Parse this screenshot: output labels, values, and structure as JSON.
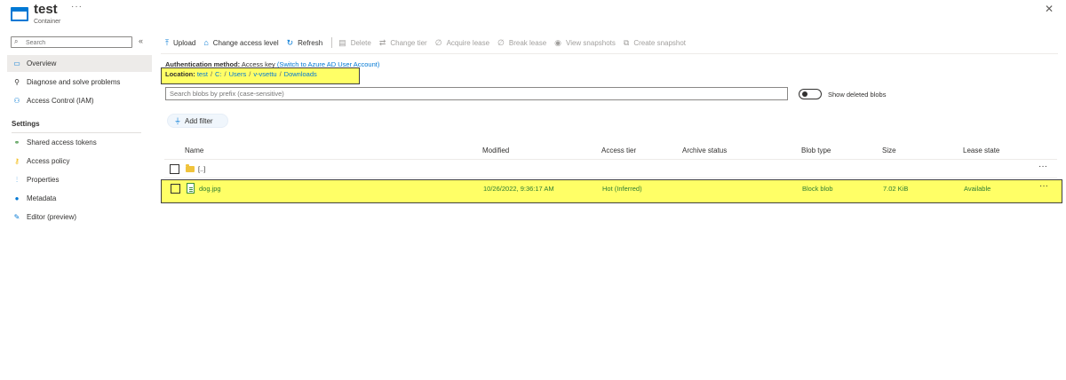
{
  "header": {
    "title": "test",
    "more_label": "···",
    "subtitle": "Container",
    "close_label": "✕"
  },
  "sidebar": {
    "search_placeholder": "Search",
    "collapse_label": "«",
    "items": [
      {
        "label": "Overview",
        "icon": "overview-icon",
        "active": true
      },
      {
        "label": "Diagnose and solve problems",
        "icon": "wrench-icon",
        "active": false
      },
      {
        "label": "Access Control (IAM)",
        "icon": "people-icon",
        "active": false
      }
    ],
    "section_title": "Settings",
    "settings_items": [
      {
        "label": "Shared access tokens",
        "icon": "link-icon"
      },
      {
        "label": "Access policy",
        "icon": "key-icon"
      },
      {
        "label": "Properties",
        "icon": "sliders-icon"
      },
      {
        "label": "Metadata",
        "icon": "info-icon"
      },
      {
        "label": "Editor (preview)",
        "icon": "pencil-icon"
      }
    ]
  },
  "toolbar": {
    "upload": "Upload",
    "change_access_level": "Change access level",
    "refresh": "Refresh",
    "delete": "Delete",
    "change_tier": "Change tier",
    "acquire_lease": "Acquire lease",
    "break_lease": "Break lease",
    "view_snapshots": "View snapshots",
    "create_snapshot": "Create snapshot"
  },
  "auth": {
    "label": "Authentication method:",
    "value": "Access key",
    "link": "(Switch to Azure AD User Account)"
  },
  "location": {
    "label": "Location:",
    "crumbs": [
      "test",
      "C:",
      "Users",
      "v-vsettu",
      "Downloads"
    ],
    "separator": "/"
  },
  "blob_search": {
    "placeholder": "Search blobs by prefix (case-sensitive)"
  },
  "show_deleted": {
    "label": "Show deleted blobs",
    "on": false
  },
  "add_filter": {
    "label": "Add filter"
  },
  "table": {
    "columns": [
      "Name",
      "Modified",
      "Access tier",
      "Archive status",
      "Blob type",
      "Size",
      "Lease state"
    ],
    "rows": [
      {
        "name": "[..]",
        "modified": "",
        "access_tier": "",
        "archive_status": "",
        "blob_type": "",
        "size": "",
        "lease_state": "",
        "type": "folder",
        "highlighted": false
      },
      {
        "name": "dog.jpg",
        "modified": "10/26/2022, 9:36:17 AM",
        "access_tier": "Hot (Inferred)",
        "archive_status": "",
        "blob_type": "Block blob",
        "size": "7.02 KiB",
        "lease_state": "Available",
        "type": "file",
        "highlighted": true
      }
    ],
    "row_menu_label": "···"
  },
  "colors": {
    "accent": "#0078d4",
    "highlight": "#ffff66",
    "folder": "#f0c33c"
  }
}
